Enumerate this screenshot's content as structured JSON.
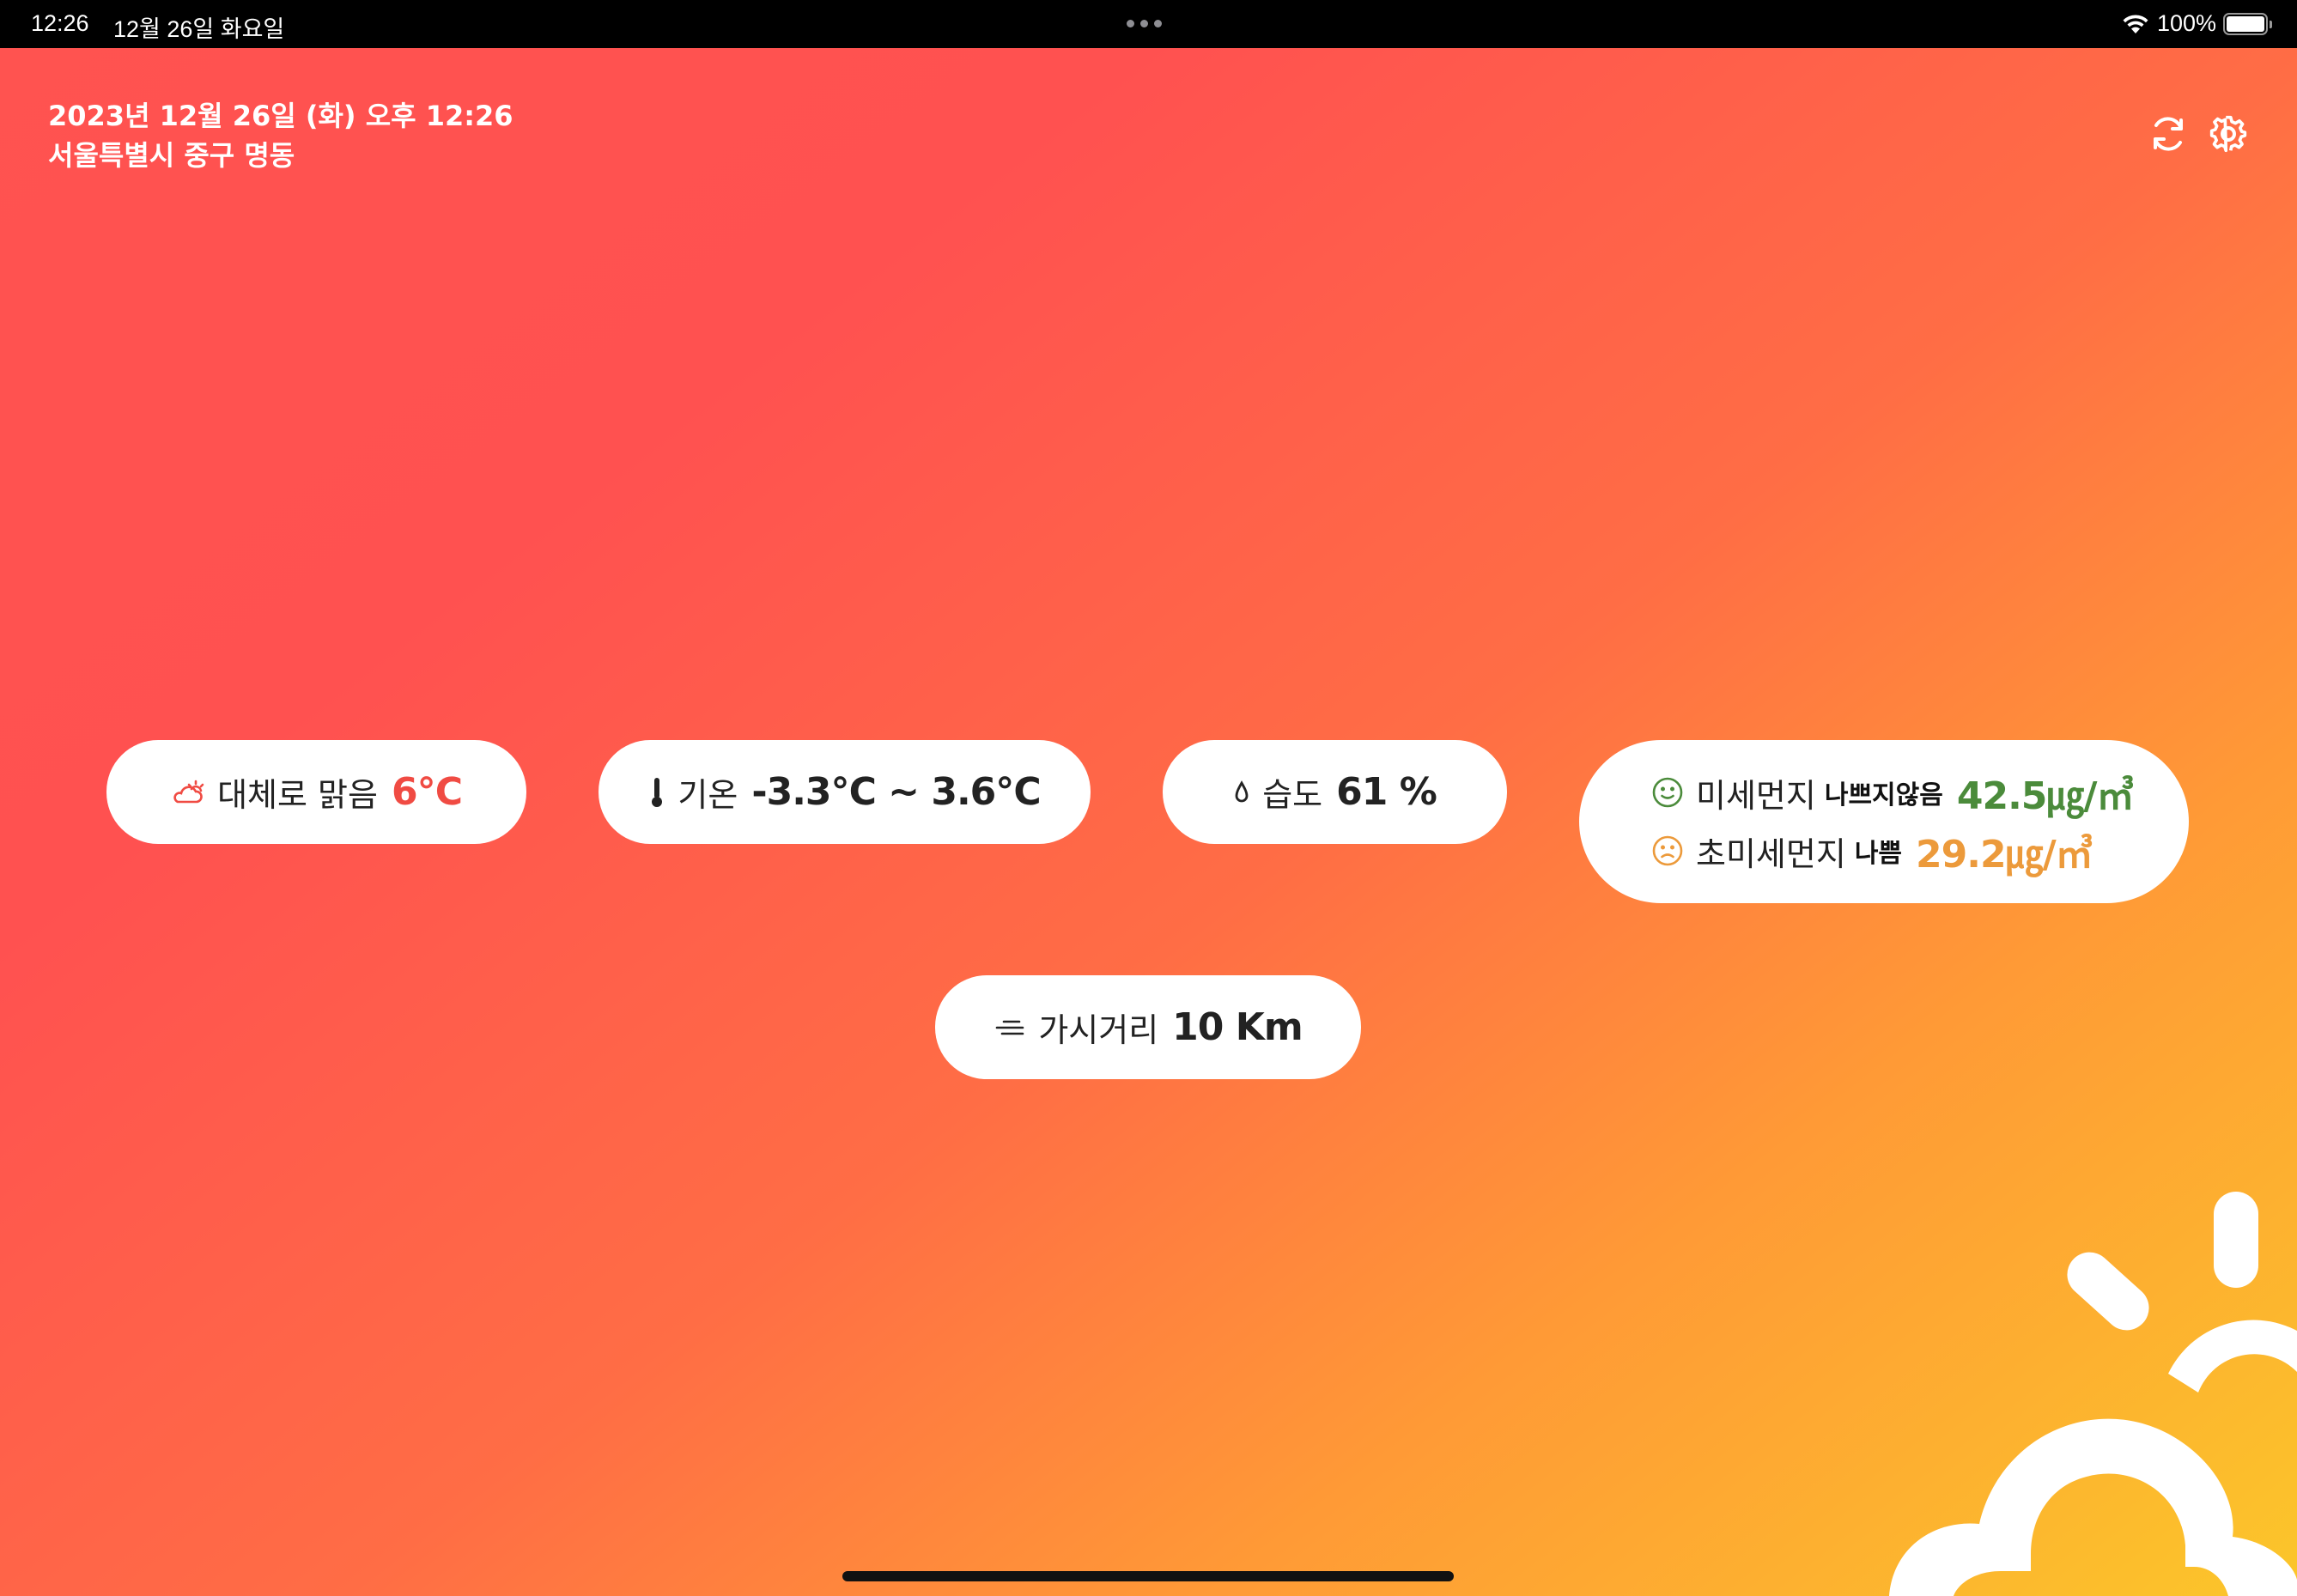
{
  "status_bar": {
    "time": "12:26",
    "date": "12월 26일 화요일",
    "battery": "100%"
  },
  "header": {
    "datetime": "2023년 12월 26일 (화) 오후 12:26",
    "location": "서울특별시 중구 명동"
  },
  "weather": {
    "condition": "대체로 맑음",
    "temperature": "6℃",
    "icon": "partly-cloudy-icon"
  },
  "temperature_range": {
    "label": "기온",
    "value": "-3.3℃ ~ 3.6℃",
    "icon": "thermometer-icon"
  },
  "humidity": {
    "label": "습도",
    "value": "61 %",
    "icon": "water-drop-icon"
  },
  "dust": {
    "pm10": {
      "label": "미세먼지",
      "grade": "나쁘지않음",
      "value": "42.5㎍/㎥",
      "icon": "smile-face-icon",
      "color": "#4b8b3b"
    },
    "pm25": {
      "label": "초미세먼지",
      "grade": "나쁨",
      "value": "29.2㎍/㎥",
      "icon": "sad-face-icon",
      "color": "#ec9a3b"
    }
  },
  "visibility": {
    "label": "가시거리",
    "value": "10 Km",
    "icon": "fog-icon"
  },
  "colors": {
    "gradient_start": "#ff5350",
    "gradient_end": "#fbc62a",
    "temp_accent": "#f04b43"
  }
}
